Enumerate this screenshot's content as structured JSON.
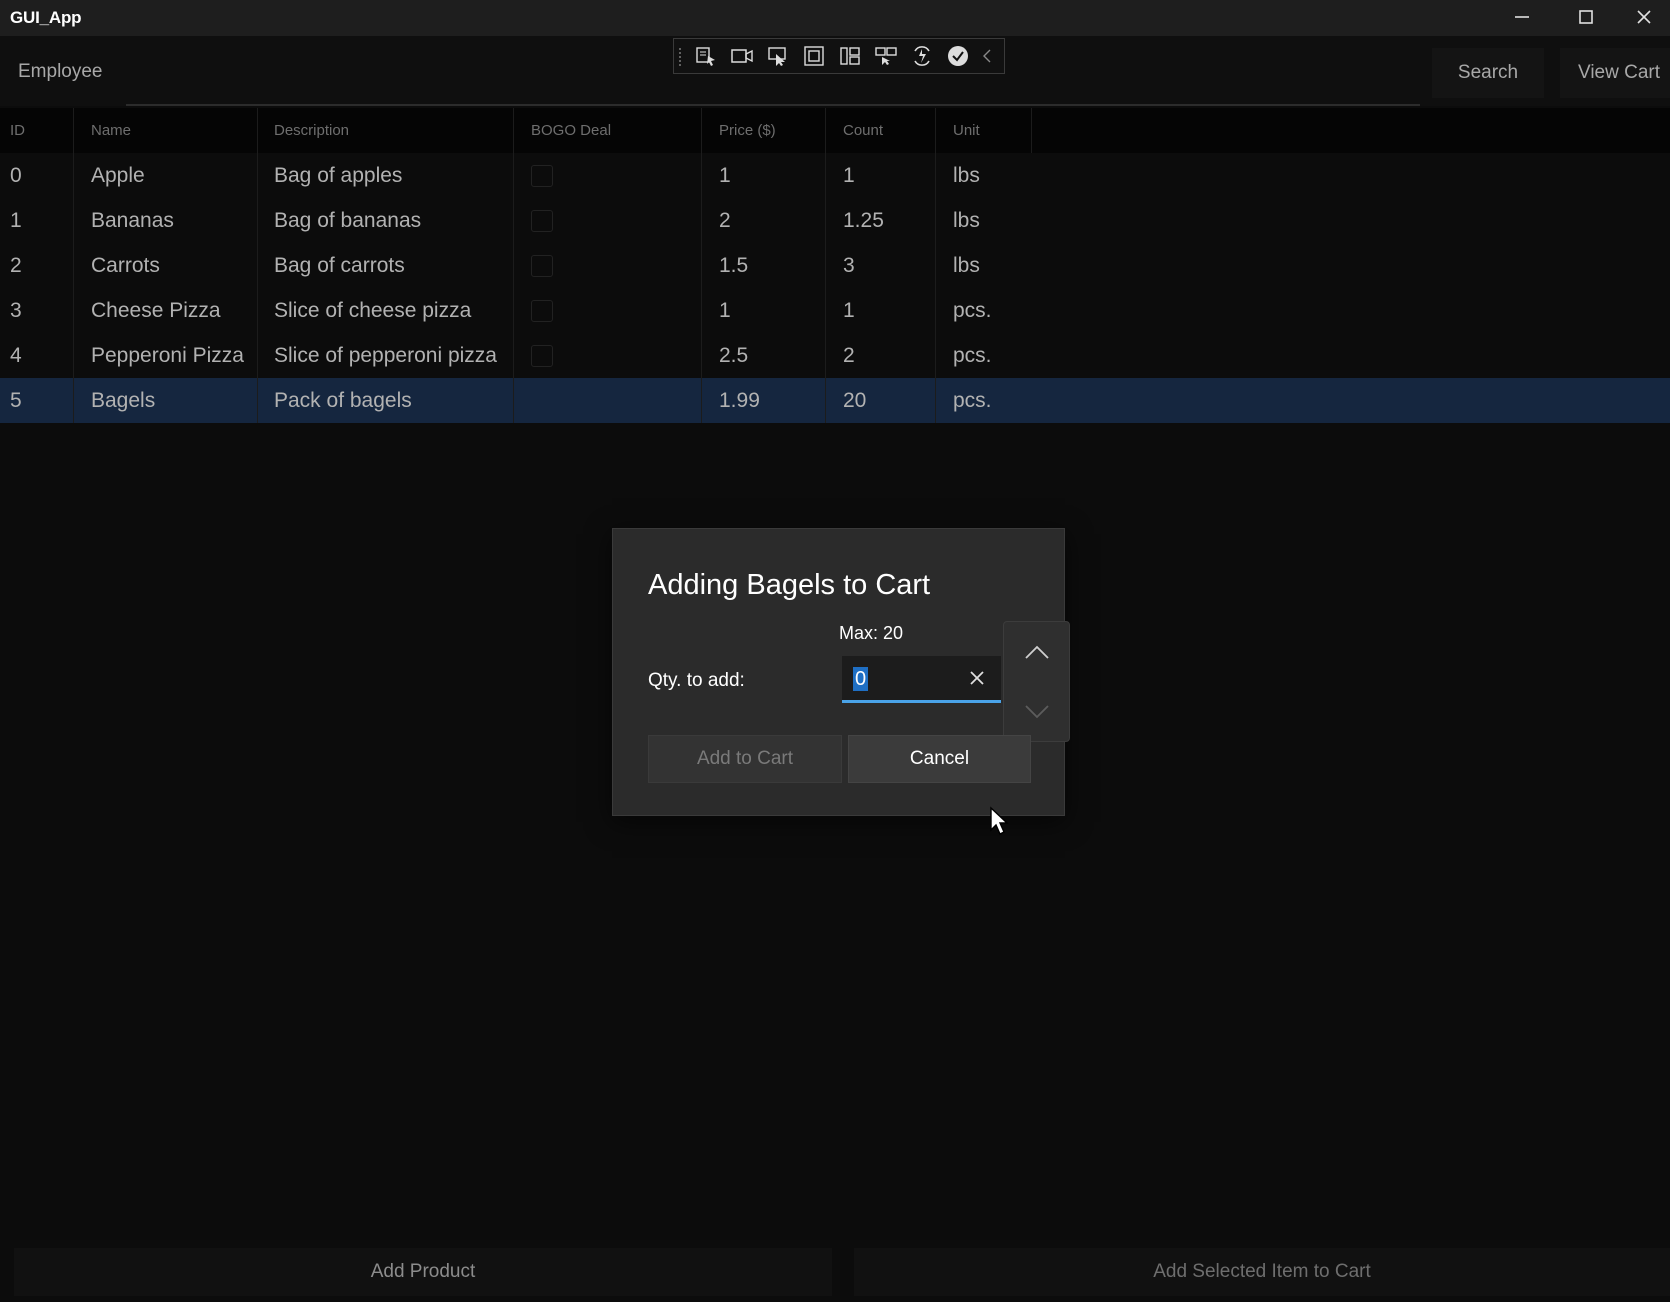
{
  "window": {
    "title": "GUI_App"
  },
  "commands": {
    "employee_label": "Employee",
    "search_label": "Search",
    "view_cart_label": "View Cart"
  },
  "table": {
    "headers": [
      "ID",
      "Name",
      "Description",
      "BOGO Deal",
      "Price ($)",
      "Count",
      "Unit"
    ],
    "rows": [
      {
        "id": "0",
        "name": "Apple",
        "description": "Bag of apples",
        "bogo": false,
        "price": "1",
        "count": "1",
        "unit": "lbs"
      },
      {
        "id": "1",
        "name": "Bananas",
        "description": "Bag of bananas",
        "bogo": false,
        "price": "2",
        "count": "1.25",
        "unit": "lbs"
      },
      {
        "id": "2",
        "name": "Carrots",
        "description": "Bag of carrots",
        "bogo": false,
        "price": "1.5",
        "count": "3",
        "unit": "lbs"
      },
      {
        "id": "3",
        "name": "Cheese Pizza",
        "description": "Slice of cheese pizza",
        "bogo": false,
        "price": "1",
        "count": "1",
        "unit": "pcs."
      },
      {
        "id": "4",
        "name": "Pepperoni Pizza",
        "description": "Slice of pepperoni pizza",
        "bogo": false,
        "price": "2.5",
        "count": "2",
        "unit": "pcs."
      },
      {
        "id": "5",
        "name": "Bagels",
        "description": "Pack of bagels",
        "bogo": false,
        "price": "1.99",
        "count": "20",
        "unit": "pcs."
      }
    ],
    "selected_row": 5
  },
  "dialog": {
    "title": "Adding Bagels to Cart",
    "max_label": "Max: 20",
    "qty_label": "Qty. to add:",
    "qty_value": "0",
    "add_button": "Add to Cart",
    "cancel_button": "Cancel"
  },
  "bottom": {
    "add_product": "Add Product",
    "add_selected": "Add Selected Item to Cart"
  },
  "colors": {
    "selection": "#15263f",
    "accent": "#4aa3e8"
  },
  "icons": {
    "toolbar": [
      "select-element-icon",
      "record-icon",
      "pointer-select-icon",
      "layout-adorner-icon",
      "track-focus-icon",
      "display-layout-icon",
      "hot-reload-icon",
      "binding-ok-icon",
      "collapse-icon"
    ]
  }
}
